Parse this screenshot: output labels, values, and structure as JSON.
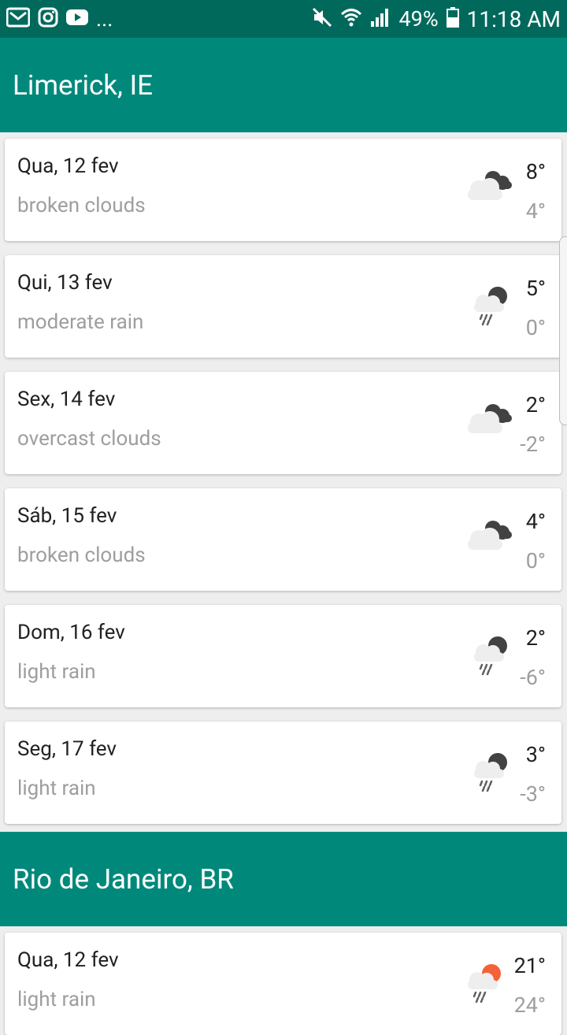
{
  "status_bar": {
    "left_icons": [
      "gmail-icon",
      "instagram-icon",
      "youtube-icon"
    ],
    "more": "...",
    "right_icons": [
      "mute-icon",
      "wifi-icon",
      "signal-icon",
      "battery-icon"
    ],
    "battery": "49%",
    "time": "11:18 AM"
  },
  "cities": [
    {
      "name": "Limerick, IE",
      "days": [
        {
          "date": "Qua, 12 fev",
          "desc": "broken clouds",
          "icon": "clouds-icon",
          "high": "8°",
          "low": "4°"
        },
        {
          "date": "Qui, 13 fev",
          "desc": "moderate rain",
          "icon": "rain-icon",
          "high": "5°",
          "low": "0°"
        },
        {
          "date": "Sex, 14 fev",
          "desc": "overcast clouds",
          "icon": "clouds-icon",
          "high": "2°",
          "low": "-2°"
        },
        {
          "date": "Sáb, 15 fev",
          "desc": "broken clouds",
          "icon": "clouds-icon",
          "high": "4°",
          "low": "0°"
        },
        {
          "date": "Dom, 16 fev",
          "desc": "light rain",
          "icon": "rain-icon",
          "high": "2°",
          "low": "-6°"
        },
        {
          "date": "Seg, 17 fev",
          "desc": "light rain",
          "icon": "rain-icon",
          "high": "3°",
          "low": "-3°"
        }
      ]
    },
    {
      "name": "Rio de Janeiro, BR",
      "days": [
        {
          "date": "Qua, 12 fev",
          "desc": "light rain",
          "icon": "sun-rain-icon",
          "high": "21°",
          "low": "24°"
        }
      ]
    }
  ],
  "colors": {
    "status_bar": "#00695c",
    "header": "#00897b",
    "background": "#eeeeee",
    "primary_text": "#212121",
    "secondary_text": "#9e9e9e"
  }
}
